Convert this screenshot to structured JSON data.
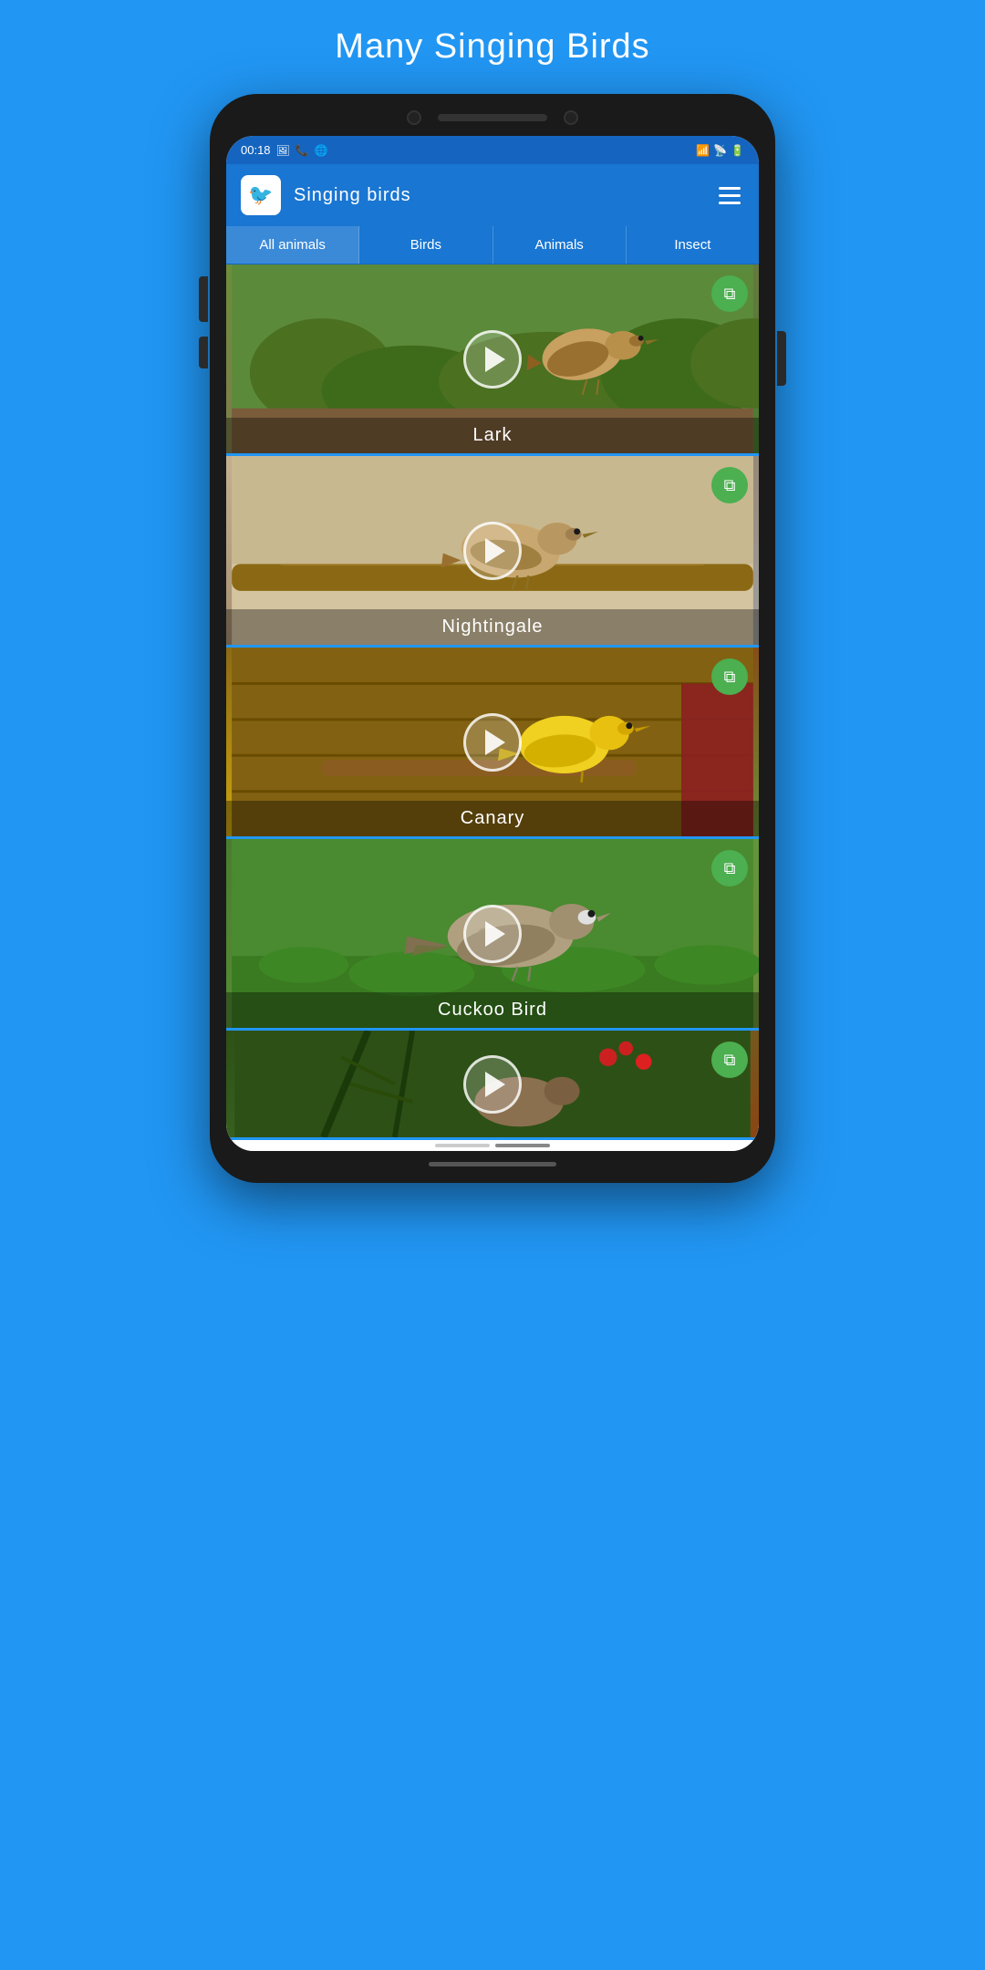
{
  "page": {
    "title": "Many Singing Birds",
    "background_color": "#2196F3"
  },
  "status_bar": {
    "time": "00:18",
    "icons": [
      "photo",
      "phone",
      "translate"
    ],
    "wifi": "wifi",
    "signal_bars": "signal",
    "battery": "battery"
  },
  "app_bar": {
    "title": "Singing birds",
    "menu_icon": "hamburger"
  },
  "tabs": [
    {
      "label": "All animals",
      "active": true
    },
    {
      "label": "Birds",
      "active": false
    },
    {
      "label": "Animals",
      "active": false
    },
    {
      "label": "Insect",
      "active": false
    }
  ],
  "birds": [
    {
      "name": "Lark",
      "emoji": "🐦",
      "bg_class": "bird-lark-bg"
    },
    {
      "name": "Nightingale",
      "emoji": "🐦",
      "bg_class": "bird-nightingale-bg"
    },
    {
      "name": "Canary",
      "emoji": "🐤",
      "bg_class": "bird-canary-bg"
    },
    {
      "name": "Cuckoo Bird",
      "emoji": "🕊️",
      "bg_class": "bird-cuckoo-bg"
    },
    {
      "name": "",
      "emoji": "🐓",
      "bg_class": "bird-fifth-bg"
    }
  ],
  "copy_button_color": "#4CAF50"
}
